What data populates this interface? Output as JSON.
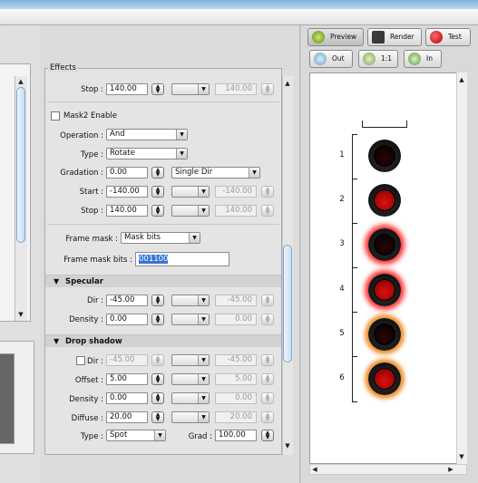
{
  "toolbar": {
    "preview": "Preview",
    "render": "Render",
    "test": "Test",
    "zoom_out": "Out",
    "zoom_1_1": "1:1",
    "zoom_in": "In"
  },
  "effects": {
    "legend": "Effects",
    "stop_top": {
      "label": "Stop :",
      "value": "140.00",
      "disabled_value": "140.00"
    },
    "mask2": {
      "label": "Mask2 Enable",
      "checked": false
    },
    "operation": {
      "label": "Operation :",
      "value": "And"
    },
    "type": {
      "label": "Type :",
      "value": "Rotate"
    },
    "gradation": {
      "label": "Gradation :",
      "value": "0.00",
      "mode": "Single Dir"
    },
    "start": {
      "label": "Start :",
      "value": "-140.00",
      "disabled_value": "-140.00"
    },
    "stop": {
      "label": "Stop :",
      "value": "140.00",
      "disabled_value": "140.00"
    },
    "frame_mask": {
      "label": "Frame mask :",
      "value": "Mask bits"
    },
    "frame_mask_bits": {
      "label": "Frame mask bits :",
      "value": "001100"
    }
  },
  "specular": {
    "title": "Specular",
    "dir": {
      "label": "Dir :",
      "value": "-45.00",
      "disabled_value": "-45.00"
    },
    "density": {
      "label": "Density :",
      "value": "0.00",
      "disabled_value": "0.00"
    }
  },
  "drop_shadow": {
    "title": "Drop shadow",
    "dir": {
      "label": "Dir :",
      "value": "-45.00",
      "disabled_value": "-45.00",
      "checked": false
    },
    "offset": {
      "label": "Offset :",
      "value": "5.00",
      "disabled_value": "5.00"
    },
    "density": {
      "label": "Density :",
      "value": "0.00",
      "disabled_value": "0.00"
    },
    "diffuse": {
      "label": "Diffuse :",
      "value": "20.00",
      "disabled_value": "20.00"
    },
    "type": {
      "label": "Type :",
      "value": "Spot"
    },
    "grad": {
      "label": "Grad :",
      "value": "100.00"
    }
  },
  "preview_rows": [
    {
      "num": "1",
      "state": "off",
      "glow": "none"
    },
    {
      "num": "2",
      "state": "on",
      "glow": "none"
    },
    {
      "num": "3",
      "state": "off",
      "glow": "red"
    },
    {
      "num": "4",
      "state": "on",
      "glow": "red"
    },
    {
      "num": "5",
      "state": "off",
      "glow": "orange"
    },
    {
      "num": "6",
      "state": "on",
      "glow": "orange"
    }
  ],
  "colors": {
    "led_on": "#e01010",
    "led_off": "#2a0606",
    "glow_red": "#ff3030",
    "glow_orange": "#f0902a",
    "accent": "#7fa5cc"
  },
  "icons": [
    "spinner-icon",
    "dropdown-arrow-icon",
    "collapse-triangle-icon",
    "preview-icon",
    "render-icon",
    "test-icon",
    "zoom-out-icon",
    "zoom-actual-icon",
    "zoom-in-icon"
  ]
}
